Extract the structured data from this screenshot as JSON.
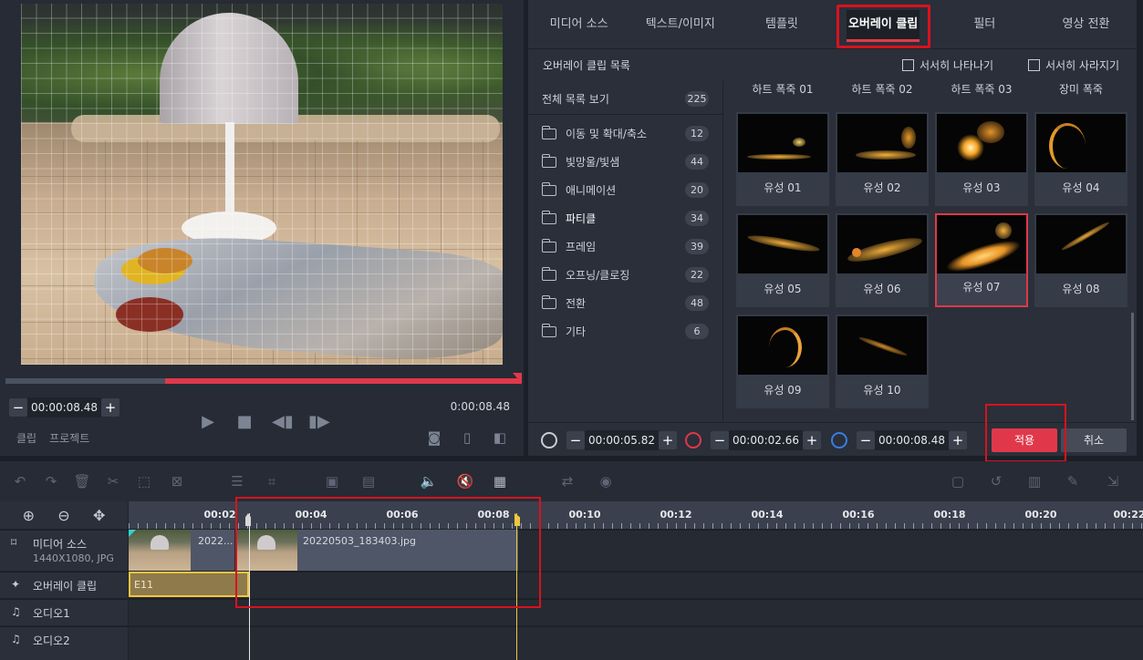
{
  "preview": {
    "current_time": "00:00:08.48",
    "total_time": "0:00:08.48",
    "tabs": [
      "클립",
      "프로젝트"
    ],
    "progress_fraction": 0.31
  },
  "right_tabs": [
    {
      "label": "미디어 소스",
      "active": false
    },
    {
      "label": "텍스트/이미지",
      "active": false
    },
    {
      "label": "템플릿",
      "active": false
    },
    {
      "label": "오버레이 클립",
      "active": true
    },
    {
      "label": "필터",
      "active": false
    },
    {
      "label": "영상 전환",
      "active": false
    }
  ],
  "overlay_list": {
    "title": "오버레이 클립 목록",
    "fade_in_label": "서서히 나타나기",
    "fade_out_label": "서서히 사라지기"
  },
  "categories": {
    "all": {
      "label": "전체 목록 보기",
      "count": "225"
    },
    "items": [
      {
        "label": "이동 및 확대/축소",
        "count": "12",
        "active": false
      },
      {
        "label": "빛망울/빛샘",
        "count": "44",
        "active": false
      },
      {
        "label": "애니메이션",
        "count": "20",
        "active": false
      },
      {
        "label": "파티클",
        "count": "34",
        "active": true
      },
      {
        "label": "프레임",
        "count": "39",
        "active": false
      },
      {
        "label": "오프닝/클로징",
        "count": "22",
        "active": false
      },
      {
        "label": "전환",
        "count": "48",
        "active": false
      },
      {
        "label": "기타",
        "count": "6",
        "active": false
      }
    ]
  },
  "thumbnails_partial": [
    "하트 폭죽 01",
    "하트 폭죽 02",
    "하트 폭죽 03",
    "장미 폭죽"
  ],
  "thumbnails": [
    {
      "label": "유성 01",
      "selected": false
    },
    {
      "label": "유성 02",
      "selected": false
    },
    {
      "label": "유성 03",
      "selected": false
    },
    {
      "label": "유성 04",
      "selected": false
    },
    {
      "label": "유성 05",
      "selected": false
    },
    {
      "label": "유성 06",
      "selected": false
    },
    {
      "label": "유성 07",
      "selected": true
    },
    {
      "label": "유성 08",
      "selected": false
    },
    {
      "label": "유성 09",
      "selected": false
    },
    {
      "label": "유성 10",
      "selected": false
    }
  ],
  "bottom_bar": {
    "start_time": "00:00:05.82",
    "duration": "00:00:02.66",
    "end_time": "00:00:08.48",
    "apply_label": "적용",
    "cancel_label": "취소"
  },
  "timeline": {
    "ruler_labels": [
      "00:02",
      "00:04",
      "00:06",
      "00:08",
      "00:10",
      "00:12",
      "00:14",
      "00:16",
      "00:18",
      "00:20",
      "00:22"
    ],
    "tracks": {
      "media": {
        "name": "미디어 소스",
        "sub": "1440X1080, JPG"
      },
      "overlay": {
        "name": "오버레이 클립"
      },
      "audio1": {
        "name": "오디오1"
      },
      "audio2": {
        "name": "오디오2"
      }
    },
    "clip_a_name": "2022...",
    "clip_b_name": "20220503_183403.jpg",
    "overlay_clip_label": "E11"
  },
  "colors": {
    "accent": "#e0384a",
    "highlight": "#d9121d",
    "playhead": "#f0c640"
  }
}
